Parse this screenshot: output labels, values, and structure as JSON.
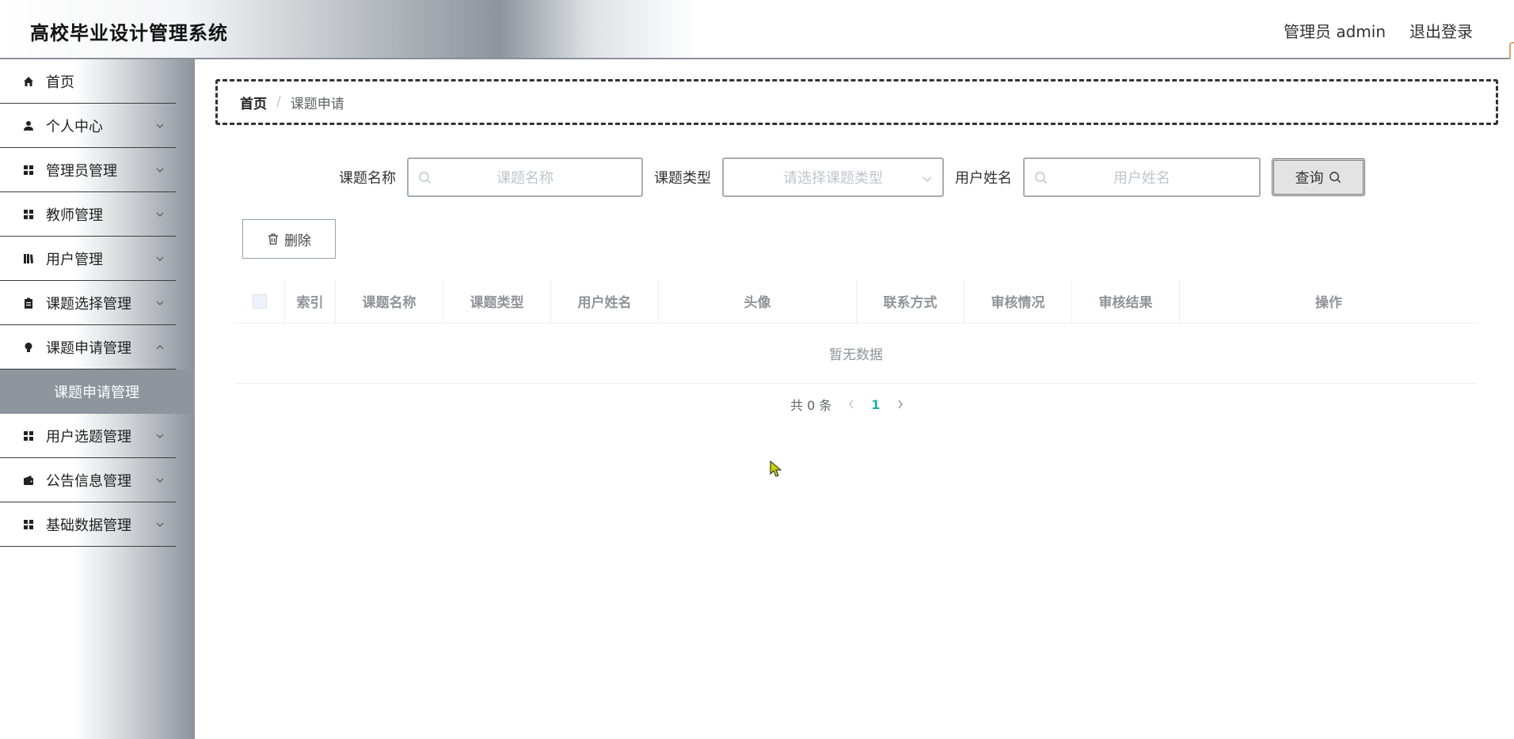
{
  "header": {
    "app_title": "高校毕业设计管理系统",
    "user_label": "管理员 admin",
    "logout_label": "退出登录"
  },
  "sidebar": {
    "items": [
      {
        "label": "首页",
        "icon": "home-icon",
        "expandable": false
      },
      {
        "label": "个人中心",
        "icon": "user-icon",
        "expandable": true
      },
      {
        "label": "管理员管理",
        "icon": "grid-icon",
        "expandable": true
      },
      {
        "label": "教师管理",
        "icon": "grid-icon",
        "expandable": true
      },
      {
        "label": "用户管理",
        "icon": "book-icon",
        "expandable": true
      },
      {
        "label": "课题选择管理",
        "icon": "clipboard-icon",
        "expandable": true
      },
      {
        "label": "课题申请管理",
        "icon": "bulb-icon",
        "expandable": true
      },
      {
        "label": "用户选题管理",
        "icon": "grid-icon",
        "expandable": true
      },
      {
        "label": "公告信息管理",
        "icon": "wallet-icon",
        "expandable": true
      },
      {
        "label": "基础数据管理",
        "icon": "grid-icon",
        "expandable": true
      }
    ],
    "active_submenu": "课题申请管理"
  },
  "breadcrumb": {
    "home": "首页",
    "separator": "/",
    "current": "课题申请"
  },
  "search": {
    "topic_name_label": "课题名称",
    "topic_name_placeholder": "课题名称",
    "topic_type_label": "课题类型",
    "topic_type_placeholder": "请选择课题类型",
    "user_name_label": "用户姓名",
    "user_name_placeholder": "用户姓名",
    "query_button": "查询"
  },
  "toolbar": {
    "delete_button": "删除"
  },
  "table": {
    "columns": [
      "索引",
      "课题名称",
      "课题类型",
      "用户姓名",
      "头像",
      "联系方式",
      "审核情况",
      "审核结果",
      "操作"
    ],
    "empty_text": "暂无数据"
  },
  "pagination": {
    "total_text": "共 0 条",
    "current_page": "1"
  },
  "colors": {
    "accent_teal": "#20b2aa",
    "sidebar_active_bg": "#8e959d",
    "header_gradient_mid": "#8d949c"
  }
}
